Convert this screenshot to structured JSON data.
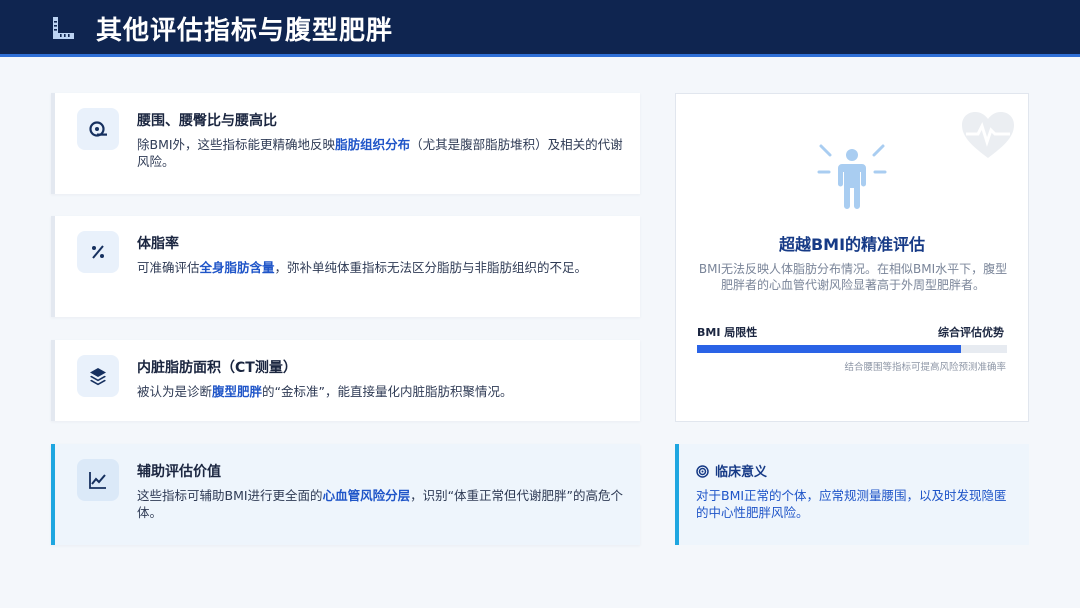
{
  "header": {
    "title": "其他评估指标与腹型肥胖",
    "logo_icon": "ruler-icon"
  },
  "cards": [
    {
      "icon": "tape-measure-icon",
      "title": "腰围、腰臀比与腰高比",
      "body_pre": "除BMI外，这些指标能更精确地反映",
      "body_em": "脂肪组织分布",
      "body_post": "（尤其是腹部脂肪堆积）及相关的代谢风险。"
    },
    {
      "icon": "percent-icon",
      "title": "体脂率",
      "body_pre": "可准确评估",
      "body_em": "全身脂肪含量",
      "body_post": "，弥补单纯体重指标无法区分脂肪与非脂肪组织的不足。"
    },
    {
      "icon": "layers-icon",
      "title": "内脏脂肪面积（CT测量）",
      "body_pre": "被认为是诊断",
      "body_em": "腹型肥胖",
      "body_post": "的“金标准”，能直接量化内脏脂肪积聚情况。"
    },
    {
      "icon": "line-chart-icon",
      "title": "辅助评估价值",
      "body_pre": "这些指标可辅助BMI进行更全面的",
      "body_em": "心血管风险分层",
      "body_post": "，识别“体重正常但代谢肥胖”的高危个体。"
    }
  ],
  "panel": {
    "title": "超越BMI的精准评估",
    "desc": "BMI无法反映人体脂肪分布情况。在相似BMI水平下，腹型肥胖者的心血管代谢风险显著高于外周型肥胖者。",
    "label_left": "BMI 局限性",
    "label_right": "综合评估优势",
    "progress_fraction": 0.85,
    "note": "结合腰围等指标可提高风险预测准确率",
    "icons": [
      "person-radiating-icon",
      "heart-pulse-icon"
    ]
  },
  "clinical": {
    "icon": "target-icon",
    "title": "临床意义",
    "body": "对于BMI正常的个体，应常规测量腰围，以及时发现隐匿的中心性肥胖风险。"
  },
  "colors": {
    "header_bg": "#0f2550",
    "accent": "#1f55c8",
    "highlight_border": "#1ea6e0",
    "progress": "#2a63e6"
  }
}
